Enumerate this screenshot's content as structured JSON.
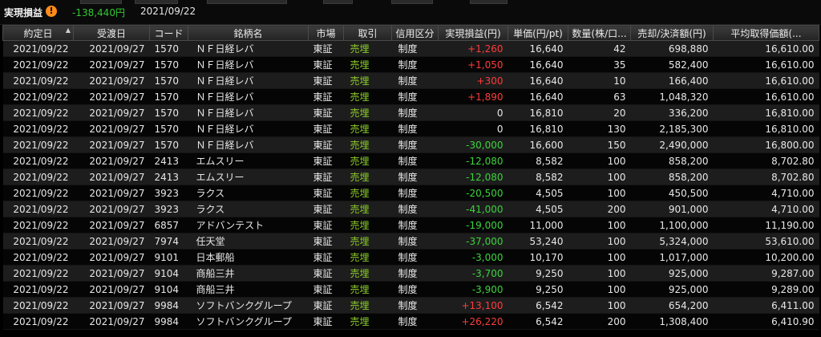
{
  "header": {
    "label": "実現損益",
    "warning_icon": "exclamation-icon",
    "total": "-138,440円",
    "date": "2021/09/22"
  },
  "columns": [
    "約定日",
    "受渡日",
    "コード",
    "銘柄名",
    "市場",
    "取引",
    "信用区分",
    "実現損益(円)",
    "単価(円/pt)",
    "数量(株/口...",
    "売却/決済額(円)",
    "平均取得価額(..."
  ],
  "sort_indicator": "▲",
  "colors": {
    "positive": "#ff3b3b",
    "negative": "#3cd43c",
    "trade": "#8ccc2a",
    "total": "#32c832",
    "warning": "#ff8c1a"
  },
  "rows": [
    {
      "exec": "2021/09/22",
      "settle": "2021/09/27",
      "code": "1570",
      "name": "ＮＦ日経レバ",
      "market": "東証",
      "trade": "売埋",
      "credit": "制度",
      "pnl": "+1,260",
      "sign": "pos",
      "price": "16,640",
      "qty": "42",
      "amount": "698,880",
      "avg": "16,610.00"
    },
    {
      "exec": "2021/09/22",
      "settle": "2021/09/27",
      "code": "1570",
      "name": "ＮＦ日経レバ",
      "market": "東証",
      "trade": "売埋",
      "credit": "制度",
      "pnl": "+1,050",
      "sign": "pos",
      "price": "16,640",
      "qty": "35",
      "amount": "582,400",
      "avg": "16,610.00"
    },
    {
      "exec": "2021/09/22",
      "settle": "2021/09/27",
      "code": "1570",
      "name": "ＮＦ日経レバ",
      "market": "東証",
      "trade": "売埋",
      "credit": "制度",
      "pnl": "+300",
      "sign": "pos",
      "price": "16,640",
      "qty": "10",
      "amount": "166,400",
      "avg": "16,610.00"
    },
    {
      "exec": "2021/09/22",
      "settle": "2021/09/27",
      "code": "1570",
      "name": "ＮＦ日経レバ",
      "market": "東証",
      "trade": "売埋",
      "credit": "制度",
      "pnl": "+1,890",
      "sign": "pos",
      "price": "16,640",
      "qty": "63",
      "amount": "1,048,320",
      "avg": "16,610.00"
    },
    {
      "exec": "2021/09/22",
      "settle": "2021/09/27",
      "code": "1570",
      "name": "ＮＦ日経レバ",
      "market": "東証",
      "trade": "売埋",
      "credit": "制度",
      "pnl": "0",
      "sign": "zero",
      "price": "16,810",
      "qty": "20",
      "amount": "336,200",
      "avg": "16,810.00"
    },
    {
      "exec": "2021/09/22",
      "settle": "2021/09/27",
      "code": "1570",
      "name": "ＮＦ日経レバ",
      "market": "東証",
      "trade": "売埋",
      "credit": "制度",
      "pnl": "0",
      "sign": "zero",
      "price": "16,810",
      "qty": "130",
      "amount": "2,185,300",
      "avg": "16,810.00"
    },
    {
      "exec": "2021/09/22",
      "settle": "2021/09/27",
      "code": "1570",
      "name": "ＮＦ日経レバ",
      "market": "東証",
      "trade": "売埋",
      "credit": "制度",
      "pnl": "-30,000",
      "sign": "neg",
      "price": "16,600",
      "qty": "150",
      "amount": "2,490,000",
      "avg": "16,800.00"
    },
    {
      "exec": "2021/09/22",
      "settle": "2021/09/27",
      "code": "2413",
      "name": "エムスリー",
      "market": "東証",
      "trade": "売埋",
      "credit": "制度",
      "pnl": "-12,080",
      "sign": "neg",
      "price": "8,582",
      "qty": "100",
      "amount": "858,200",
      "avg": "8,702.80"
    },
    {
      "exec": "2021/09/22",
      "settle": "2021/09/27",
      "code": "2413",
      "name": "エムスリー",
      "market": "東証",
      "trade": "売埋",
      "credit": "制度",
      "pnl": "-12,080",
      "sign": "neg",
      "price": "8,582",
      "qty": "100",
      "amount": "858,200",
      "avg": "8,702.80"
    },
    {
      "exec": "2021/09/22",
      "settle": "2021/09/27",
      "code": "3923",
      "name": "ラクス",
      "market": "東証",
      "trade": "売埋",
      "credit": "制度",
      "pnl": "-20,500",
      "sign": "neg",
      "price": "4,505",
      "qty": "100",
      "amount": "450,500",
      "avg": "4,710.00"
    },
    {
      "exec": "2021/09/22",
      "settle": "2021/09/27",
      "code": "3923",
      "name": "ラクス",
      "market": "東証",
      "trade": "売埋",
      "credit": "制度",
      "pnl": "-41,000",
      "sign": "neg",
      "price": "4,505",
      "qty": "200",
      "amount": "901,000",
      "avg": "4,710.00"
    },
    {
      "exec": "2021/09/22",
      "settle": "2021/09/27",
      "code": "6857",
      "name": "アドバンテスト",
      "market": "東証",
      "trade": "売埋",
      "credit": "制度",
      "pnl": "-19,000",
      "sign": "neg",
      "price": "11,000",
      "qty": "100",
      "amount": "1,100,000",
      "avg": "11,190.00"
    },
    {
      "exec": "2021/09/22",
      "settle": "2021/09/27",
      "code": "7974",
      "name": "任天堂",
      "market": "東証",
      "trade": "売埋",
      "credit": "制度",
      "pnl": "-37,000",
      "sign": "neg",
      "price": "53,240",
      "qty": "100",
      "amount": "5,324,000",
      "avg": "53,610.00"
    },
    {
      "exec": "2021/09/22",
      "settle": "2021/09/27",
      "code": "9101",
      "name": "日本郵船",
      "market": "東証",
      "trade": "売埋",
      "credit": "制度",
      "pnl": "-3,000",
      "sign": "neg",
      "price": "10,170",
      "qty": "100",
      "amount": "1,017,000",
      "avg": "10,200.00"
    },
    {
      "exec": "2021/09/22",
      "settle": "2021/09/27",
      "code": "9104",
      "name": "商船三井",
      "market": "東証",
      "trade": "売埋",
      "credit": "制度",
      "pnl": "-3,700",
      "sign": "neg",
      "price": "9,250",
      "qty": "100",
      "amount": "925,000",
      "avg": "9,287.00"
    },
    {
      "exec": "2021/09/22",
      "settle": "2021/09/27",
      "code": "9104",
      "name": "商船三井",
      "market": "東証",
      "trade": "売埋",
      "credit": "制度",
      "pnl": "-3,900",
      "sign": "neg",
      "price": "9,250",
      "qty": "100",
      "amount": "925,000",
      "avg": "9,289.00"
    },
    {
      "exec": "2021/09/22",
      "settle": "2021/09/27",
      "code": "9984",
      "name": "ソフトバンクグループ",
      "market": "東証",
      "trade": "売埋",
      "credit": "制度",
      "pnl": "+13,100",
      "sign": "pos",
      "price": "6,542",
      "qty": "100",
      "amount": "654,200",
      "avg": "6,411.00"
    },
    {
      "exec": "2021/09/22",
      "settle": "2021/09/27",
      "code": "9984",
      "name": "ソフトバンクグループ",
      "market": "東証",
      "trade": "売埋",
      "credit": "制度",
      "pnl": "+26,220",
      "sign": "pos",
      "price": "6,542",
      "qty": "200",
      "amount": "1,308,400",
      "avg": "6,410.90"
    }
  ]
}
